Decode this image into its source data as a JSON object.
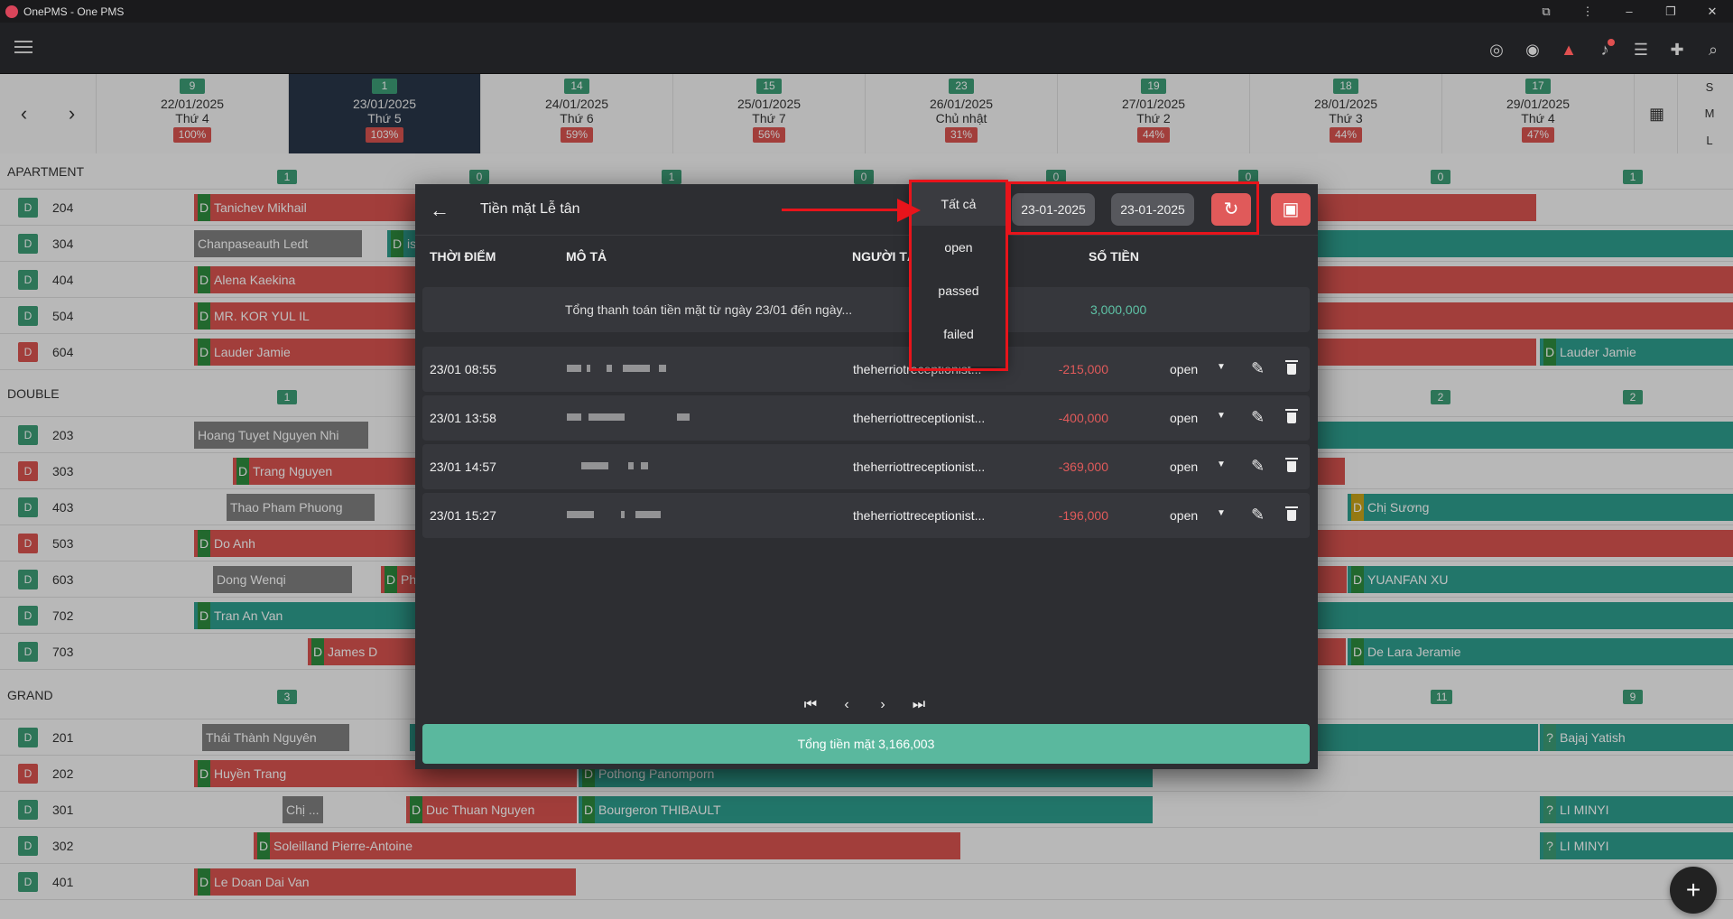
{
  "window": {
    "title": "OnePMS - One PMS"
  },
  "days": [
    {
      "count": "9",
      "date": "22/01/2025",
      "weekday": "Thứ 4",
      "occ": "100%"
    },
    {
      "count": "1",
      "date": "23/01/2025",
      "weekday": "Thứ 5",
      "occ": "103%"
    },
    {
      "count": "14",
      "date": "24/01/2025",
      "weekday": "Thứ 6",
      "occ": "59%"
    },
    {
      "count": "15",
      "date": "25/01/2025",
      "weekday": "Thứ 7",
      "occ": "56%"
    },
    {
      "count": "23",
      "date": "26/01/2025",
      "weekday": "Chủ nhật",
      "occ": "31%"
    },
    {
      "count": "19",
      "date": "27/01/2025",
      "weekday": "Thứ 2",
      "occ": "44%"
    },
    {
      "count": "18",
      "date": "28/01/2025",
      "weekday": "Thứ 3",
      "occ": "44%"
    },
    {
      "count": "17",
      "date": "29/01/2025",
      "weekday": "Thứ 4",
      "occ": "47%"
    }
  ],
  "size_toggle": [
    "S",
    "M",
    "L"
  ],
  "groups": {
    "apartment": {
      "name": "APARTMENT",
      "counts": [
        "1",
        "0",
        "1",
        "0",
        "0",
        "0",
        "0",
        "1"
      ]
    },
    "double": {
      "name": "DOUBLE",
      "counts": [
        "1",
        "2",
        "2"
      ]
    },
    "grand": {
      "name": "GRAND",
      "counts": [
        "3",
        "11",
        "9"
      ]
    }
  },
  "rooms": {
    "r204": {
      "badge": "D",
      "num": "204"
    },
    "r304": {
      "badge": "D",
      "num": "304"
    },
    "r404": {
      "badge": "D",
      "num": "404"
    },
    "r504": {
      "badge": "D",
      "num": "504"
    },
    "r604": {
      "badge": "D",
      "num": "604"
    },
    "r203": {
      "badge": "D",
      "num": "203"
    },
    "r303": {
      "badge": "D",
      "num": "303"
    },
    "r403": {
      "badge": "D",
      "num": "403"
    },
    "r503": {
      "badge": "D",
      "num": "503"
    },
    "r603": {
      "badge": "D",
      "num": "603"
    },
    "r702": {
      "badge": "D",
      "num": "702"
    },
    "r703": {
      "badge": "D",
      "num": "703"
    },
    "r201": {
      "badge": "D",
      "num": "201"
    },
    "r202": {
      "badge": "D",
      "num": "202"
    },
    "r301": {
      "badge": "D",
      "num": "301"
    },
    "r302": {
      "badge": "D",
      "num": "302"
    },
    "r401": {
      "badge": "D",
      "num": "401"
    }
  },
  "bookings": {
    "b1": "Tanichev Mikhail",
    "b2": "Chanpaseauth Ledt",
    "b3": "is",
    "b4": "Alena Kaekina",
    "b5": "MR. KOR YUL IL",
    "b6": "Lauder Jamie",
    "b7": "Lauder Jamie",
    "b8": "Hoang Tuyet Nguyen Nhi",
    "b9": "Trang Nguyen",
    "b10": "Thao Pham Phuong",
    "b11": "Chị Sương",
    "b12": "Do Anh",
    "b13": "Dong Wenqi",
    "b14": "Ph",
    "b15": "YUANFAN XU",
    "b16": "Tran An Van",
    "b17": "James D",
    "b18": "De Lara Jeramie",
    "b19": "Thái Thành Nguyên",
    "b20": "Bajaj Yatish",
    "b21": "Huyền Trang",
    "b22": "Pothong Panomporn",
    "b23": "Chị ...",
    "b24": "Duc Thuan Nguyen",
    "b25": "Bourgeron THIBAULT",
    "b26": "LI MINYI",
    "b27": "Soleilland Pierre-Antoine",
    "b28": "LI MINYI",
    "b29": "Le Doan Dai Van"
  },
  "modal": {
    "title": "Tiền mặt Lễ tân",
    "date_from": "23-01-2025",
    "date_to": "23-01-2025",
    "columns": {
      "time": "THỜI ĐIỂM",
      "desc": "MÔ TẢ",
      "user": "NGƯỜI TẠ",
      "amount": "SỐ TIỀN"
    },
    "summary": {
      "text": "Tổng thanh toán tiền mặt từ ngày 23/01 đến ngày...",
      "amount": "3,000,000"
    },
    "rows": [
      {
        "time": "23/01 08:55",
        "user": "theherriotreceptionist...",
        "amount": "-215,000",
        "state": "open"
      },
      {
        "time": "23/01 13:58",
        "user": "theherriottreceptionist...",
        "amount": "-400,000",
        "state": "open"
      },
      {
        "time": "23/01 14:57",
        "user": "theherriottreceptionist...",
        "amount": "-369,000",
        "state": "open"
      },
      {
        "time": "23/01 15:27",
        "user": "theherriottreceptionist...",
        "amount": "-196,000",
        "state": "open"
      }
    ],
    "total": "Tổng tiền mặt 3,166,003"
  },
  "dropdown": {
    "options": [
      "Tất cả",
      "open",
      "passed",
      "failed"
    ]
  },
  "colors": {
    "accent_red": "#e05a5a",
    "teal": "#5ab89e",
    "annotation": "#e8141b"
  }
}
